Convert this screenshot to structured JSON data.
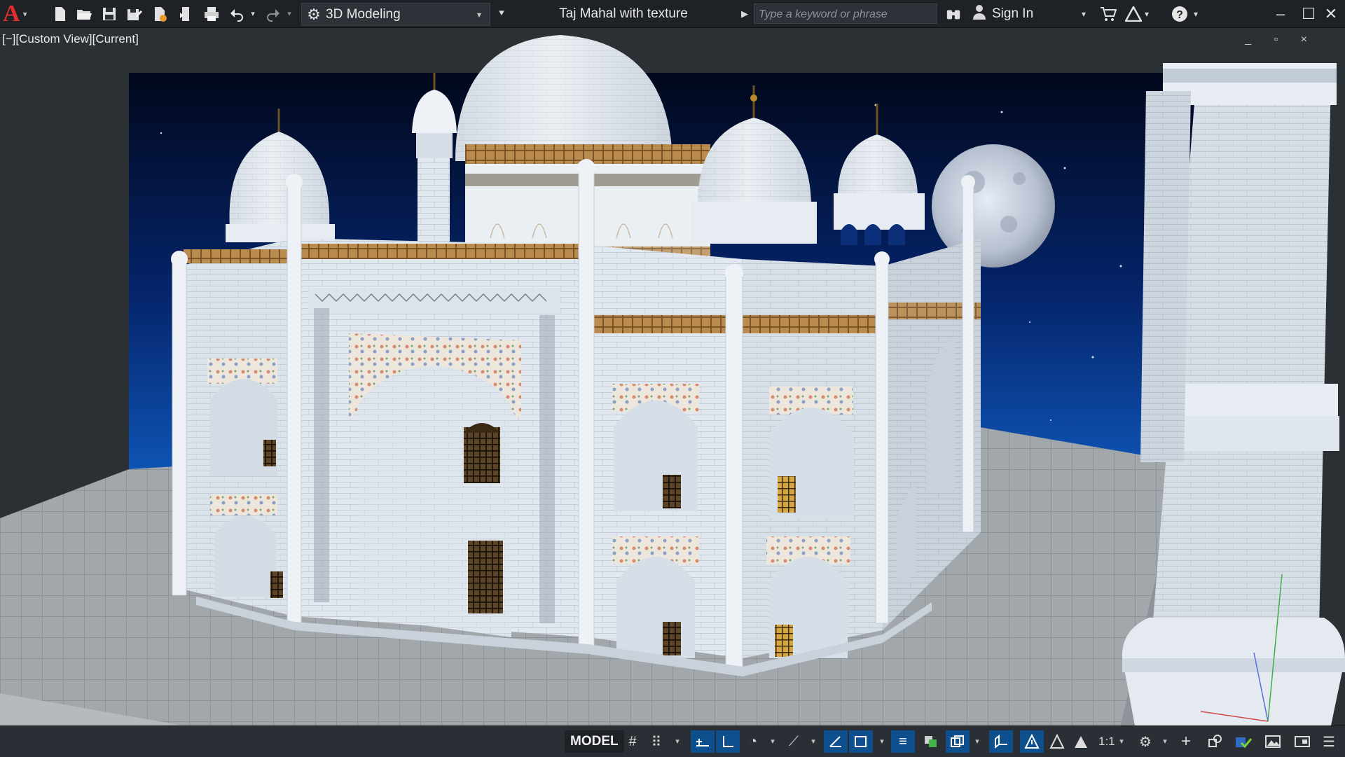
{
  "app": {
    "logo_letter": "A",
    "brand_color": "#e52d2d"
  },
  "quick_access": {
    "items": [
      "new-icon",
      "open-icon",
      "save-icon",
      "save-as-icon",
      "open-from-web-icon",
      "save-to-web-icon",
      "plot-icon",
      "undo-icon",
      "redo-icon"
    ]
  },
  "workspace": {
    "label": "3D Modeling",
    "caret": "▾"
  },
  "document": {
    "title": "Taj Mahal with texture final.dwg"
  },
  "search": {
    "placeholder": "Type a keyword or phrase"
  },
  "account": {
    "sign_in": "Sign In"
  },
  "viewport": {
    "label": "[−][Custom View][Current]",
    "controls": "_ ▫ ×",
    "colors": {
      "sky_top": "#02081c",
      "sky_bottom": "#0e54b4",
      "marble": "#e4ebf2",
      "floor": "#9ea3a8"
    }
  },
  "statusbar": {
    "model_tab": "MODEL",
    "scale": "1:1",
    "accent": "#0e4f8e"
  }
}
